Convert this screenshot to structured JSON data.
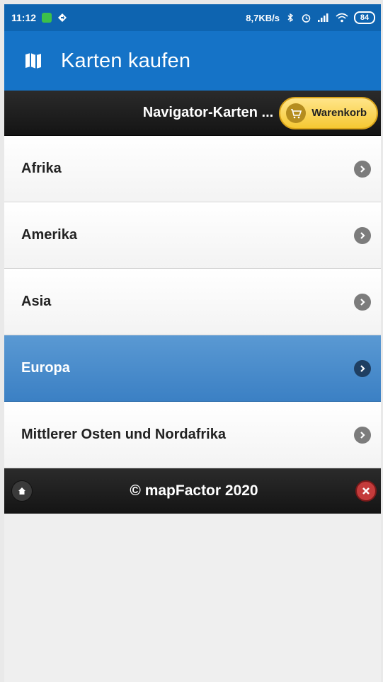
{
  "statusbar": {
    "time": "11:12",
    "speed": "8,7KB/s",
    "battery": "84"
  },
  "appbar": {
    "title": "Karten kaufen",
    "icon": "map-icon"
  },
  "header": {
    "title": "Navigator-Karten ...",
    "cart_label": "Warenkorb"
  },
  "regions": [
    {
      "label": "Afrika",
      "selected": false
    },
    {
      "label": "Amerika",
      "selected": false
    },
    {
      "label": "Asia",
      "selected": false
    },
    {
      "label": "Europa",
      "selected": true
    },
    {
      "label": "Mittlerer Osten und Nordafrika",
      "selected": false
    }
  ],
  "footer": {
    "copyright": "© mapFactor 2020"
  },
  "colors": {
    "statusbar": "#0e64b0",
    "appbar": "#1573c7",
    "selected": "#4a8ccb",
    "cart": "#f6c832",
    "close": "#c43b3b"
  }
}
